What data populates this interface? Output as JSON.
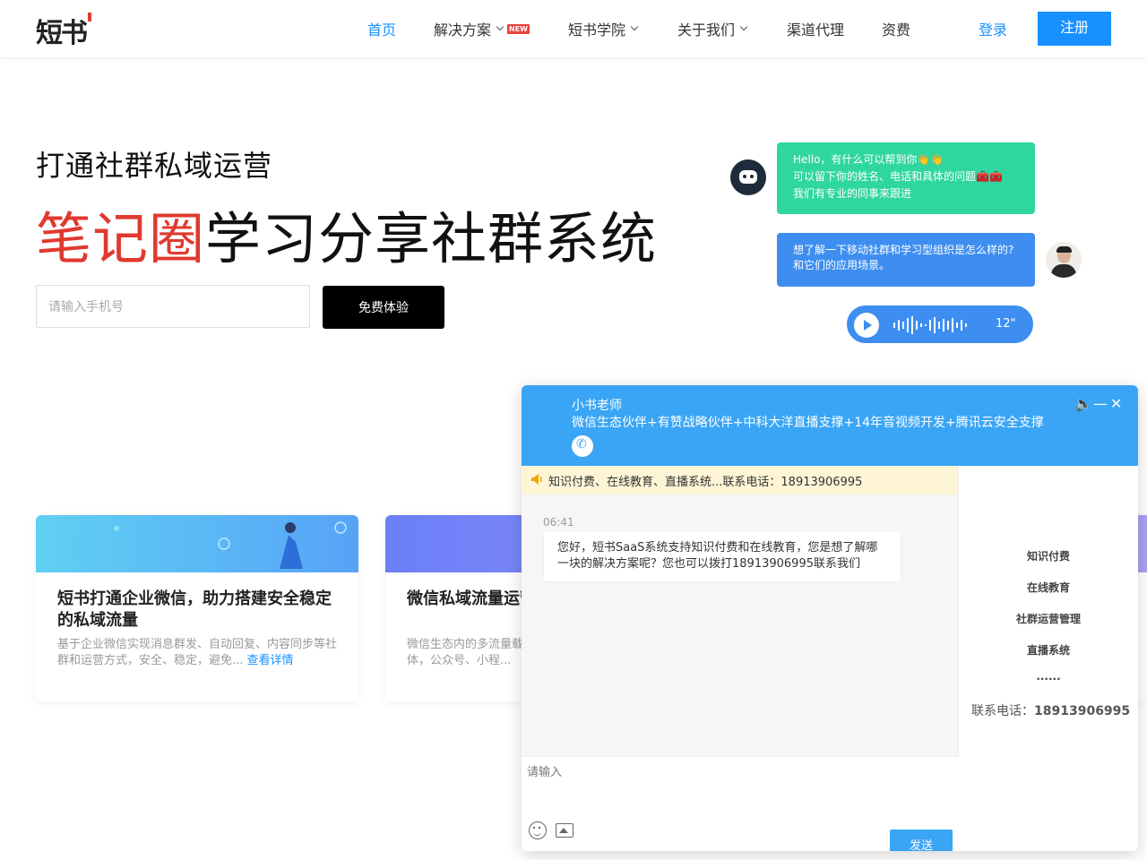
{
  "header": {
    "logo": "短书",
    "nav": [
      {
        "label": "首页"
      },
      {
        "label": "解决方案",
        "badge": "NEW"
      },
      {
        "label": "短书学院"
      },
      {
        "label": "关于我们"
      },
      {
        "label": "渠道代理"
      },
      {
        "label": "资费"
      }
    ],
    "login": "登录",
    "register": "注册",
    "accent_color": "#1890ff"
  },
  "hero": {
    "subtitle": "打通社群私域运营",
    "title_highlight": "笔记圈",
    "title_rest": "学习分享社群系统",
    "phone_placeholder": "请输入手机号",
    "trial_button": "免费体验"
  },
  "illustration": {
    "green_bubble": [
      "Hello，有什么可以帮到你👋👋",
      "可以留下你的姓名、电话和具体的问题🧰🧰",
      "我们有专业的同事来跟进"
    ],
    "blue_bubble": [
      "想了解一下移动社群和学习型组织是怎么样的?",
      "和它们的应用场景。"
    ],
    "voice_duration": "12\""
  },
  "cards": [
    {
      "title": "短书打通企业微信，助力搭建安全稳定的私域流量",
      "desc": "基于企业微信实现消息群发、自动回复、内容同步等社群和运营方式，安全、稳定，避免...",
      "more": "查看详情"
    },
    {
      "title": "微信私域流量运营",
      "desc": "微信生态内的多流量载体，公众号、小程..."
    }
  ],
  "chat_widget": {
    "agent_name": "小书老师",
    "slogan": "微信生态伙伴+有赞战略伙伴+中科大洋直播支撑+14年音视频开发+腾讯云安全支撑",
    "notice": "知识付费、在线教育、直播系统...联系电话：18913906995",
    "message_time": "06:41",
    "message": "您好，短书SaaS系统支持知识付费和在线教育，您是想了解哪一块的解决方案呢？您也可以拨打18913906995联系我们",
    "input_placeholder": "请输入",
    "send": "发送",
    "side_items": [
      "知识付费",
      "在线教育",
      "社群运营管理",
      "直播系统",
      "......"
    ],
    "contact_label": "联系电话：",
    "contact_phone": "18913906995",
    "theme_color": "#3aa5f5"
  }
}
